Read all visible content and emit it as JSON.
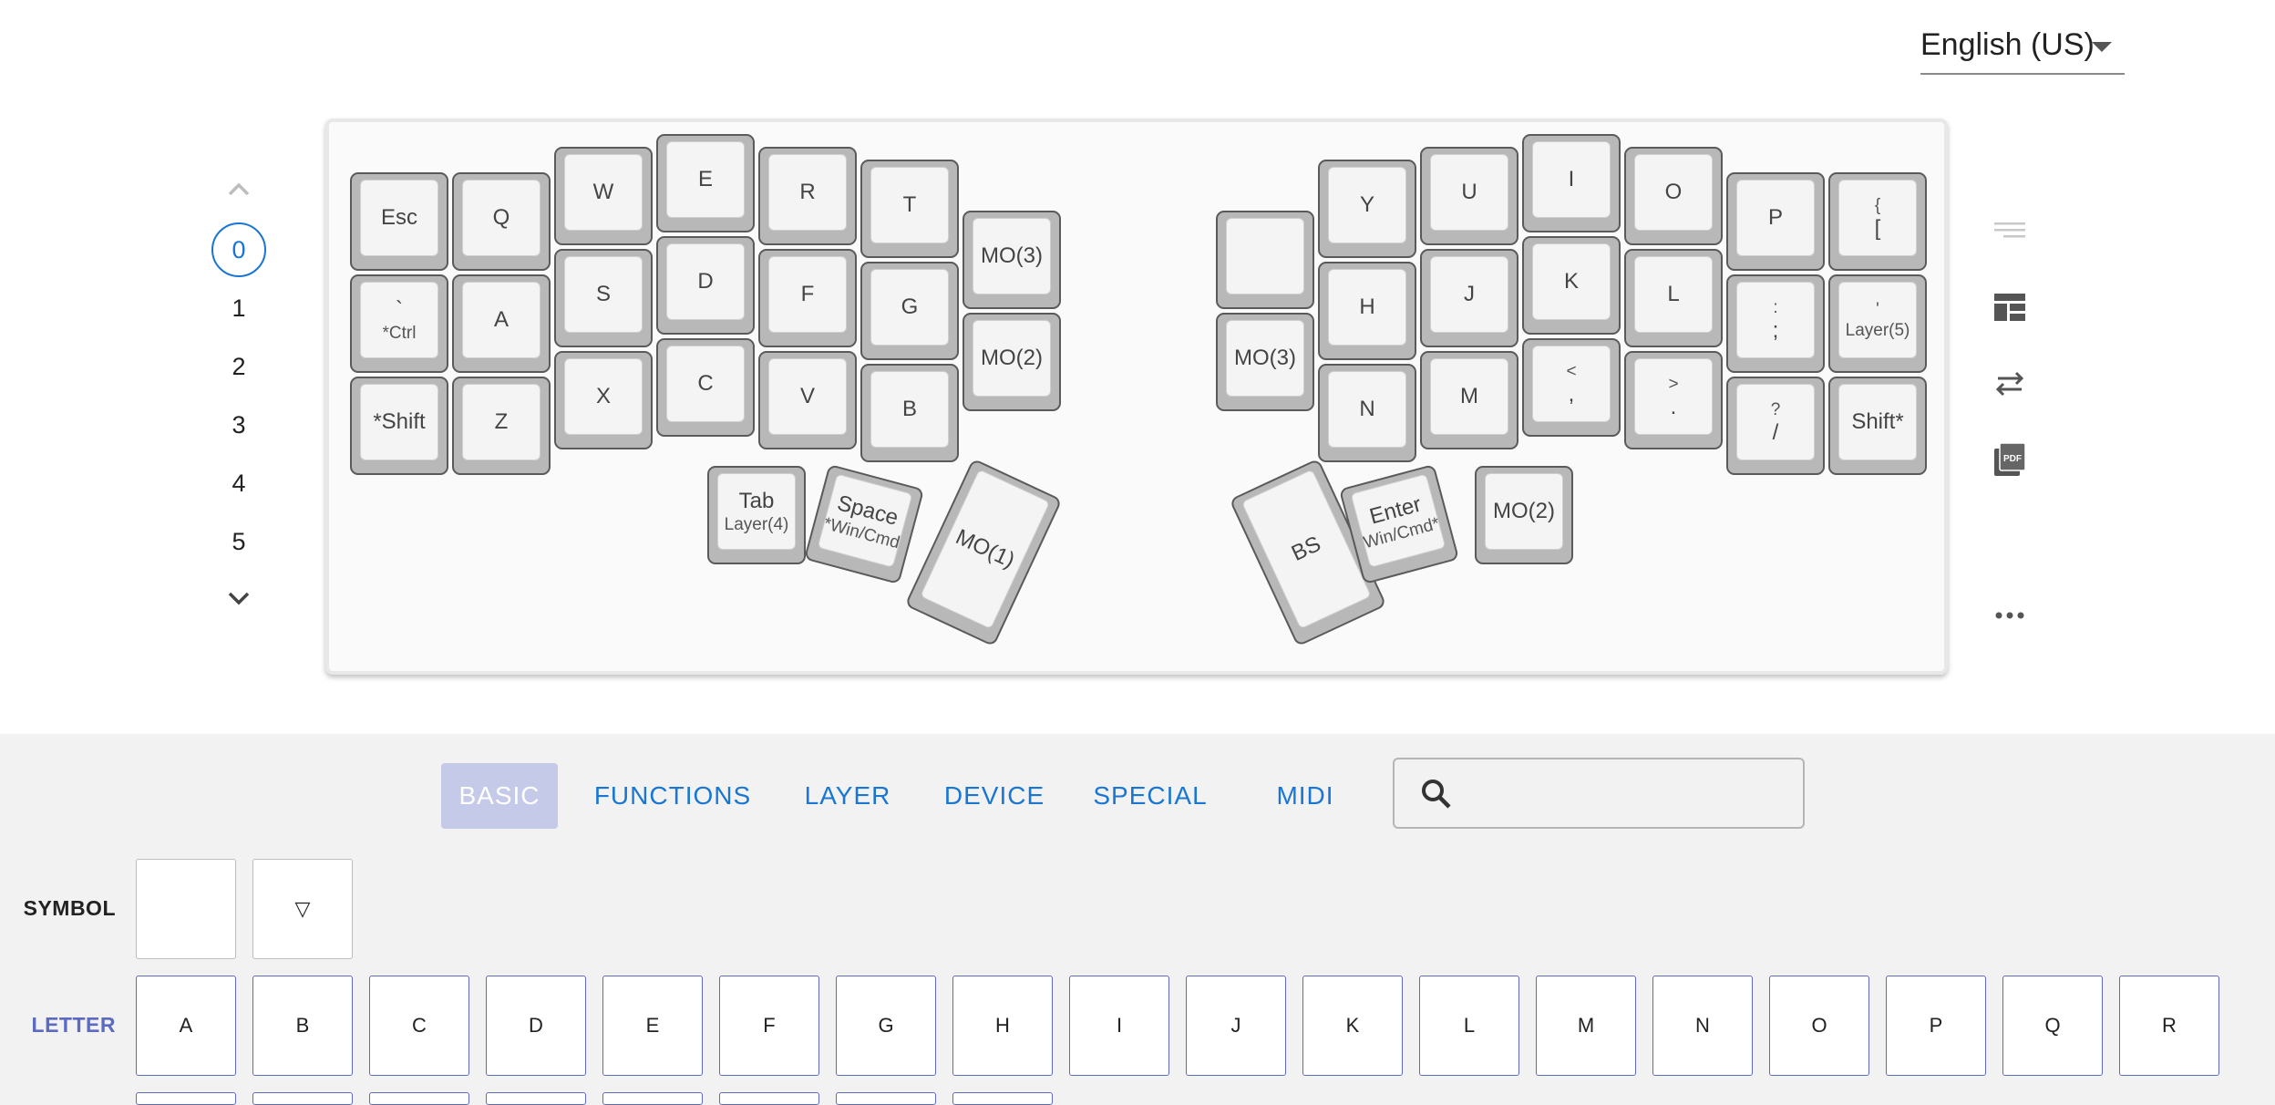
{
  "language": {
    "selected": "English (US)"
  },
  "layers": {
    "items": [
      "0",
      "1",
      "2",
      "3",
      "4",
      "5"
    ],
    "selected": "0"
  },
  "keys": {
    "esc": {
      "main": "Esc"
    },
    "q": {
      "main": "Q"
    },
    "w": {
      "main": "W"
    },
    "e": {
      "main": "E"
    },
    "r": {
      "main": "R"
    },
    "t": {
      "main": "T"
    },
    "mo3_l": {
      "main": "MO(3)"
    },
    "grave": {
      "main": "`",
      "sub": "*Ctrl"
    },
    "a": {
      "main": "A"
    },
    "s": {
      "main": "S"
    },
    "d": {
      "main": "D"
    },
    "f": {
      "main": "F"
    },
    "g": {
      "main": "G"
    },
    "mo2_l": {
      "main": "MO(2)"
    },
    "lshift": {
      "main": "*Shift"
    },
    "z": {
      "main": "Z"
    },
    "x": {
      "main": "X"
    },
    "c": {
      "main": "C"
    },
    "v": {
      "main": "V"
    },
    "b": {
      "main": "B"
    },
    "tab": {
      "main": "Tab",
      "sub": "Layer(4)"
    },
    "space": {
      "main": "Space",
      "sub": "*Win/Cmd"
    },
    "mo1": {
      "main": "MO(1)"
    },
    "blank": {
      "main": ""
    },
    "y": {
      "main": "Y"
    },
    "u": {
      "main": "U"
    },
    "i": {
      "main": "I"
    },
    "o": {
      "main": "O"
    },
    "p": {
      "main": "P"
    },
    "bracket": {
      "top": "{",
      "main": "["
    },
    "mo3_r": {
      "main": "MO(3)"
    },
    "h": {
      "main": "H"
    },
    "j": {
      "main": "J"
    },
    "k": {
      "main": "K"
    },
    "l": {
      "main": "L"
    },
    "semi": {
      "top": ":",
      "main": ";"
    },
    "quote": {
      "top": "'",
      "sub": "Layer(5)"
    },
    "n": {
      "main": "N"
    },
    "m": {
      "main": "M"
    },
    "comma": {
      "top": "<",
      "main": ","
    },
    "dot": {
      "top": ">",
      "main": "."
    },
    "slash": {
      "top": "?",
      "main": "/"
    },
    "rshift": {
      "main": "Shift*"
    },
    "bs": {
      "main": "BS"
    },
    "enter": {
      "main": "Enter",
      "sub": "Win/Cmd*"
    },
    "mo2_r": {
      "main": "MO(2)"
    }
  },
  "tools": [
    "lines-icon",
    "layout-icon",
    "swap-arrows-icon",
    "pdf-icon",
    "more-icon"
  ],
  "tabs": [
    "BASIC",
    "FUNCTIONS",
    "LAYER",
    "DEVICE",
    "SPECIAL",
    "MIDI"
  ],
  "selected_tab": "BASIC",
  "search": {
    "placeholder": ""
  },
  "palette": {
    "symbol_label": "SYMBOL",
    "symbol_keys": [
      "",
      "▽"
    ],
    "letter_label": "LETTER",
    "letter_keys": [
      "A",
      "B",
      "C",
      "D",
      "E",
      "F",
      "G",
      "H",
      "I",
      "J",
      "K",
      "L",
      "M",
      "N",
      "O",
      "P",
      "Q",
      "R"
    ]
  },
  "colors": {
    "accent": "#1976d2",
    "selected_tab_bg": "#c5cae9",
    "letter_label": "#5c6bc0"
  }
}
